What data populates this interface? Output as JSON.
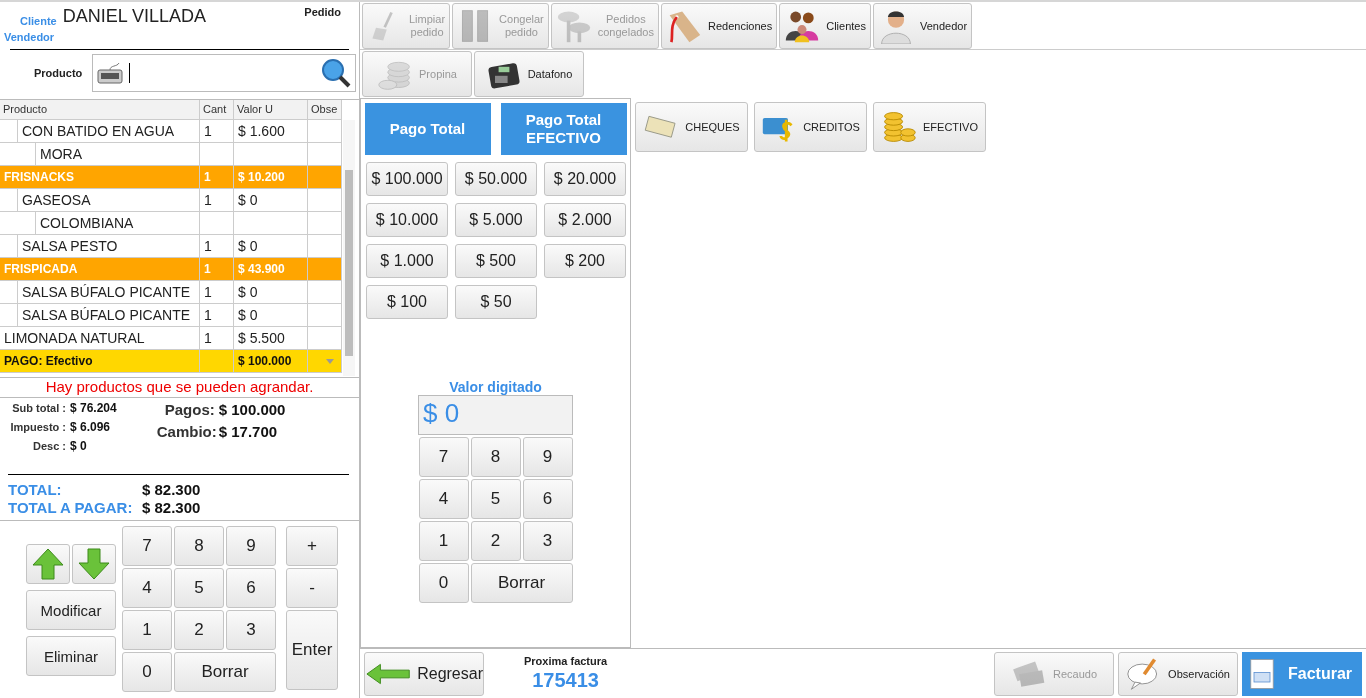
{
  "order_panel": {
    "client_label": "Cliente",
    "client_name": "DANIEL VILLADA",
    "order_label": "Pedido",
    "seller_label": "Vendedor",
    "product_label": "Producto"
  },
  "table": {
    "columns": [
      "Producto",
      "Cant",
      "Valor U",
      "Obse"
    ],
    "rows": [
      {
        "kind": "continued",
        "children": [
          {
            "kind": "item",
            "product": "CON BATIDO EN AGUA",
            "qty": "1",
            "price": "$ 1.600",
            "children": [
              {
                "kind": "item",
                "product": "MORA"
              }
            ]
          }
        ]
      },
      {
        "kind": "group",
        "product": "FRISNACKS",
        "qty": "1",
        "price": "$ 10.200",
        "children": [
          {
            "kind": "item",
            "product": "GASEOSA",
            "qty": "1",
            "price": "$ 0",
            "children": [
              {
                "kind": "item",
                "product": "COLOMBIANA"
              }
            ]
          },
          {
            "kind": "item",
            "product": "SALSA PESTO",
            "qty": "1",
            "price": "$ 0"
          }
        ]
      },
      {
        "kind": "group",
        "product": "FRISPICADA",
        "qty": "1",
        "price": "$ 43.900",
        "children": [
          {
            "kind": "item",
            "product": "SALSA BÚFALO PICANTE",
            "qty": "1",
            "price": "$ 0"
          },
          {
            "kind": "item",
            "product": "SALSA BÚFALO PICANTE",
            "qty": "1",
            "price": "$ 0"
          }
        ]
      },
      {
        "kind": "item",
        "product": "LIMONADA NATURAL",
        "qty": "1",
        "price": "$ 5.500"
      },
      {
        "kind": "payment",
        "product": "PAGO: Efectivo",
        "price": "$ 100.000"
      }
    ]
  },
  "warning": "Hay productos que se pueden agrandar.",
  "summary": {
    "lines": [
      {
        "label": "Sub total :",
        "value": "$ 76.204"
      },
      {
        "label": "Impuesto :",
        "value": "$ 6.096"
      },
      {
        "label": "Desc :",
        "value": "$ 0"
      }
    ],
    "payments": [
      {
        "label": "Pagos:",
        "value": "$ 100.000"
      },
      {
        "label": "Cambio:",
        "value": "$ 17.700"
      }
    ],
    "totals": [
      {
        "label": "TOTAL:",
        "value": "$ 82.300"
      },
      {
        "label": "TOTAL A PAGAR:",
        "value": "$ 82.300"
      }
    ]
  },
  "order_keypad": {
    "actions": [
      "Modificar",
      "Eliminar"
    ],
    "keys": [
      "7",
      "8",
      "9",
      "4",
      "5",
      "6",
      "1",
      "2",
      "3",
      "0",
      "Borrar"
    ],
    "side_keys": [
      "+",
      "-",
      "Enter"
    ]
  },
  "toolbar": [
    {
      "label": "Limpiar\npedido",
      "disabled": true
    },
    {
      "label": "Congelar\npedido",
      "disabled": true
    },
    {
      "label": "Pedidos\ncongelados",
      "disabled": true
    },
    {
      "label": "Redenciones",
      "disabled": false
    },
    {
      "label": "Clientes",
      "disabled": false
    },
    {
      "label": "Vendedor",
      "disabled": false
    }
  ],
  "toolbar_2": [
    {
      "label": "Propina",
      "disabled": true
    },
    {
      "label": "Datafono",
      "disabled": false
    }
  ],
  "payment": {
    "quick_pay": [
      "Pago Total",
      "Pago Total\nEFECTIVO"
    ],
    "bills": [
      "$ 100.000",
      "$ 50.000",
      "$ 20.000",
      "$ 10.000",
      "$ 5.000",
      "$ 2.000",
      "$ 1.000",
      "$ 500",
      "$ 200",
      "$ 100",
      "$ 50"
    ],
    "entry": {
      "label": "Valor digitado",
      "value": "$ 0"
    },
    "keys": [
      "7",
      "8",
      "9",
      "4",
      "5",
      "6",
      "1",
      "2",
      "3",
      "0",
      "Borrar"
    ]
  },
  "methods": [
    "CHEQUES",
    "CREDITOS",
    "EFECTIVO"
  ],
  "bottom_bar": {
    "back": "Regresar",
    "next_invoice_label": "Proxima factura",
    "next_invoice": "175413",
    "actions": [
      {
        "label": "Recaudo",
        "disabled": true
      },
      {
        "label": "Observación",
        "disabled": false
      }
    ],
    "submit": "Facturar"
  }
}
